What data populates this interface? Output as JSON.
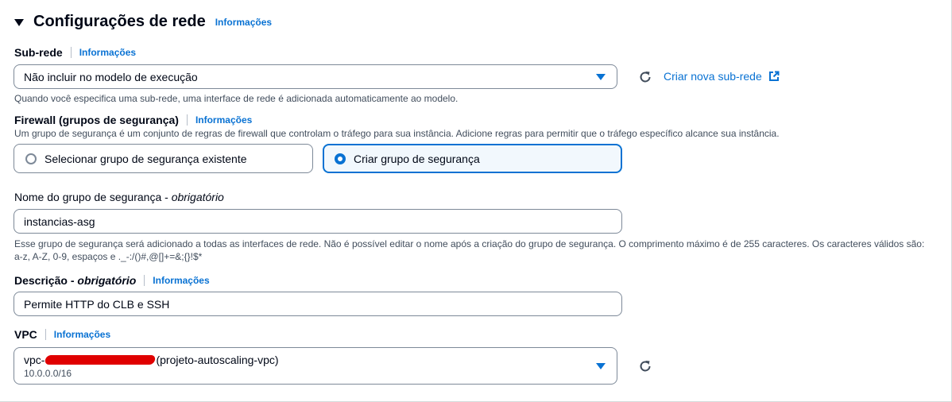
{
  "section": {
    "title": "Configurações de rede",
    "info_link": "Informações"
  },
  "subnet": {
    "label": "Sub-rede",
    "info_link": "Informações",
    "selected_value": "Não incluir no modelo de execução",
    "create_link": "Criar nova sub-rede",
    "hint": "Quando você especifica uma sub-rede, uma interface de rede é adicionada automaticamente ao modelo."
  },
  "firewall": {
    "label": "Firewall (grupos de segurança)",
    "info_link": "Informações",
    "description": "Um grupo de segurança é um conjunto de regras de firewall que controlam o tráfego para sua instância. Adicione regras para permitir que o tráfego específico alcance sua instância.",
    "options": [
      {
        "label": "Selecionar grupo de segurança existente",
        "selected": false
      },
      {
        "label": "Criar grupo de segurança",
        "selected": true
      }
    ]
  },
  "sg_name": {
    "label": "Nome do grupo de segurança",
    "required_text": "obrigatório",
    "value": "instancias-asg",
    "hint_line1": "Esse grupo de segurança será adicionado a todas as interfaces de rede. Não é possível editar o nome após a criação do grupo de segurança. O comprimento máximo é de 255 caracteres. Os caracteres válidos são:",
    "hint_line2": "a-z, A-Z, 0-9, espaços e ._-:/()#,@[]+=&;{}!$*"
  },
  "description_field": {
    "label": "Descrição",
    "required_text": "obrigatório",
    "info_link": "Informações",
    "value": "Permite HTTP do CLB e SSH"
  },
  "vpc": {
    "label": "VPC",
    "info_link": "Informações",
    "prefix": "vpc-",
    "name": "(projeto-autoscaling-vpc)",
    "cidr": "10.0.0.0/16"
  },
  "colors": {
    "link": "#0972d3",
    "border": "#7d8998",
    "text": "#000716",
    "redaction": "#e00000"
  }
}
